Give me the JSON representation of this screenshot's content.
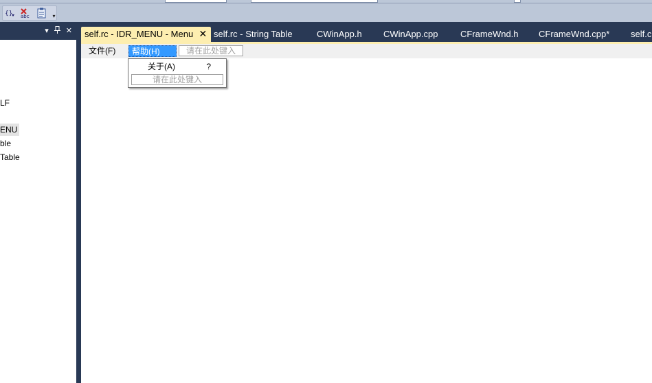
{
  "toolbar": {
    "buttons": [
      {
        "name": "code-view-icon",
        "glyph": "{}"
      },
      {
        "name": "spellcheck-icon",
        "glyph": "abc"
      },
      {
        "name": "clipboard-icon",
        "glyph": "▤"
      }
    ],
    "overflow_glyph": "▾"
  },
  "left_panel": {
    "header_icons": {
      "dropdown": "▾",
      "pin": "⊥",
      "close": "✕"
    },
    "items": [
      {
        "label": "LF",
        "selected": false
      },
      {
        "label": "ENU",
        "selected": true
      },
      {
        "label": "ble",
        "selected": false
      },
      {
        "label": "Table",
        "selected": false
      }
    ]
  },
  "tabs": [
    {
      "label": "self.rc - IDR_MENU - Menu",
      "active": true
    },
    {
      "label": "self.rc - String Table",
      "active": false
    },
    {
      "label": "CWinApp.h",
      "active": false
    },
    {
      "label": "CWinApp.cpp",
      "active": false
    },
    {
      "label": "CFrameWnd.h",
      "active": false
    },
    {
      "label": "CFrameWnd.cpp*",
      "active": false
    },
    {
      "label": "self.c",
      "active": false
    }
  ],
  "tab_close_glyph": "✕",
  "menu_editor": {
    "menubar": {
      "file": "文件(F)",
      "help": "帮助(H)",
      "placeholder": "请在此处键入"
    },
    "dropdown": {
      "about_label": "关于(A)",
      "about_shortcut": "?",
      "placeholder": "请在此处键入"
    }
  },
  "colors": {
    "chrome_dark": "#293955",
    "active_tab": "#fdeeb0",
    "menu_highlight": "#3399ff"
  }
}
